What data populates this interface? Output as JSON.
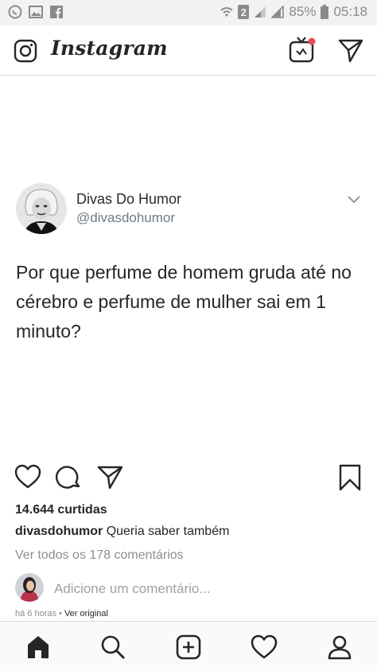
{
  "status_bar": {
    "left_icons": [
      "whatsapp-icon",
      "image-icon",
      "facebook-icon"
    ],
    "right_icons": [
      "wifi-icon",
      "sim-icon",
      "signal-icon",
      "battery-icon"
    ],
    "sim_number": "2",
    "battery": "85%",
    "time": "05:18"
  },
  "header": {
    "logo_text": "Instagram",
    "icons": [
      "camera-icon",
      "igtv-icon",
      "direct-icon"
    ],
    "notification_dot_color": "#ed4956"
  },
  "post": {
    "tweet": {
      "name": "Divas Do Humor",
      "handle": "@divasdohumor",
      "text": "Por que perfume de homem gruda até no cérebro e perfume de mulher sai em 1 minuto?"
    },
    "actions": [
      "heart-icon",
      "comment-icon",
      "share-icon",
      "bookmark-icon"
    ],
    "likes": "14.644 curtidas",
    "caption_user": "divasdohumor",
    "caption_text": "Queria saber também",
    "view_comments": "Ver todos os 178 comentários",
    "add_comment_placeholder": "Adicione um comentário...",
    "time_ago": "há 6 horas",
    "separator": " • ",
    "see_original": "Ver original"
  },
  "bottom_nav": [
    "home-icon",
    "search-icon",
    "new-post-icon",
    "activity-icon",
    "profile-icon"
  ],
  "colors": {
    "text": "#262626",
    "muted": "#8e8e8e",
    "handle": "#6e7b86",
    "statusbar_bg": "#f2f2f2"
  }
}
